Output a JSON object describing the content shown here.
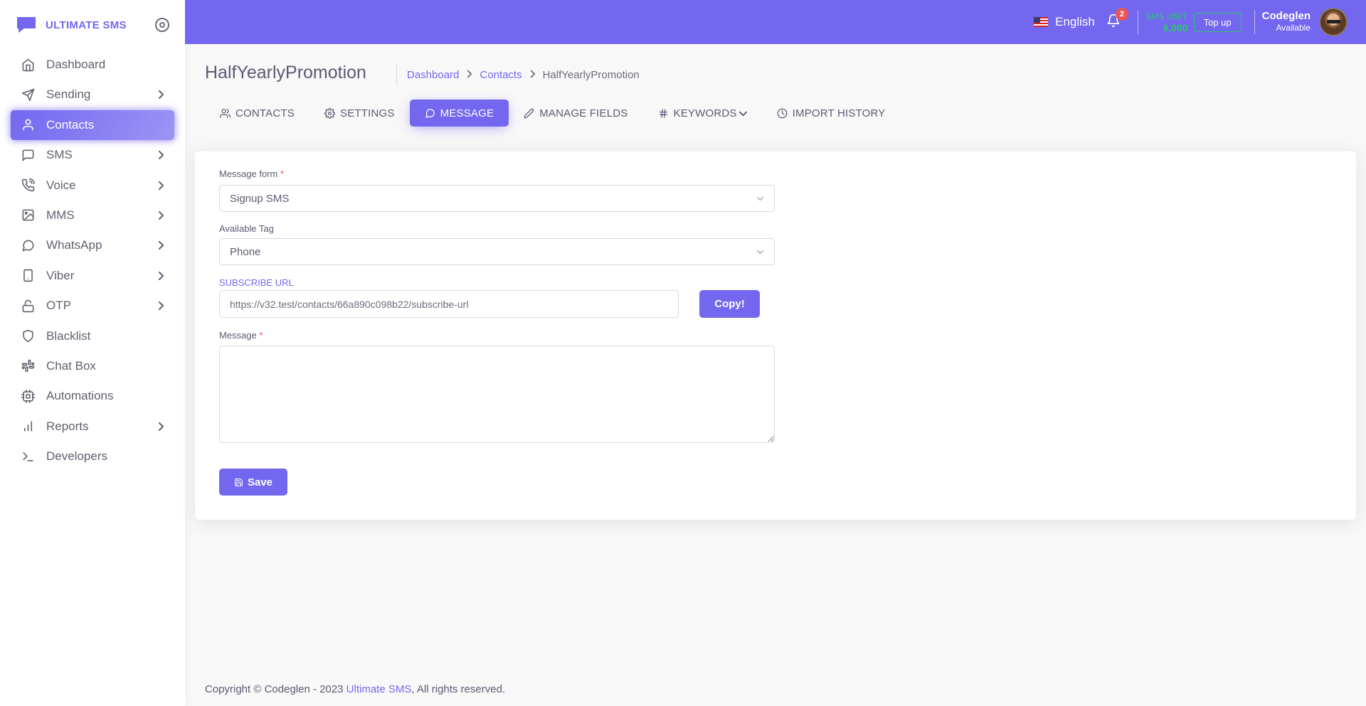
{
  "brand": {
    "name": "ULTIMATE SMS"
  },
  "sidebar": {
    "items": [
      {
        "label": "Dashboard",
        "icon": "home-icon",
        "has_children": false,
        "active": false
      },
      {
        "label": "Sending",
        "icon": "send-icon",
        "has_children": true,
        "active": false
      },
      {
        "label": "Contacts",
        "icon": "user-icon",
        "has_children": false,
        "active": true
      },
      {
        "label": "SMS",
        "icon": "message-square-icon",
        "has_children": true,
        "active": false
      },
      {
        "label": "Voice",
        "icon": "phone-call-icon",
        "has_children": true,
        "active": false
      },
      {
        "label": "MMS",
        "icon": "image-icon",
        "has_children": true,
        "active": false
      },
      {
        "label": "WhatsApp",
        "icon": "message-circle-icon",
        "has_children": true,
        "active": false
      },
      {
        "label": "Viber",
        "icon": "tablet-icon",
        "has_children": true,
        "active": false
      },
      {
        "label": "OTP",
        "icon": "unlock-icon",
        "has_children": true,
        "active": false
      },
      {
        "label": "Blacklist",
        "icon": "shield-icon",
        "has_children": false,
        "active": false
      },
      {
        "label": "Chat Box",
        "icon": "slack-icon",
        "has_children": false,
        "active": false
      },
      {
        "label": "Automations",
        "icon": "cpu-icon",
        "has_children": false,
        "active": false
      },
      {
        "label": "Reports",
        "icon": "bar-chart-icon",
        "has_children": true,
        "active": false
      },
      {
        "label": "Developers",
        "icon": "terminal-icon",
        "has_children": false,
        "active": false
      }
    ]
  },
  "navbar": {
    "language": "English",
    "notification_count": "2",
    "sms_unit_label": "SMS UNIT",
    "sms_unit_value": "6,000",
    "topup_label": "Top up",
    "user_name": "Codeglen",
    "user_status": "Available"
  },
  "header": {
    "title": "HalfYearlyPromotion",
    "breadcrumb": [
      "Dashboard",
      "Contacts",
      "HalfYearlyPromotion"
    ]
  },
  "tabs": [
    {
      "label": "CONTACTS",
      "icon": "users-icon",
      "active": false
    },
    {
      "label": "SETTINGS",
      "icon": "settings-icon",
      "active": false
    },
    {
      "label": "MESSAGE",
      "icon": "message-circle-icon",
      "active": true
    },
    {
      "label": "MANAGE FIELDS",
      "icon": "edit-icon",
      "active": false
    },
    {
      "label": "KEYWORDS",
      "icon": "hash-icon",
      "active": false
    },
    {
      "label": "IMPORT HISTORY",
      "icon": "clock-icon",
      "active": false
    }
  ],
  "form": {
    "message_form_label": "Message form",
    "message_form_value": "Signup SMS",
    "available_tag_label": "Available Tag",
    "available_tag_value": "Phone",
    "subscribe_url_label": "SUBSCRIBE URL",
    "subscribe_url_value": "https://v32.test/contacts/66a890c098b22/subscribe-url",
    "copy_label": "Copy!",
    "message_label": "Message",
    "message_value": "",
    "required_mark": "*",
    "save_label": "Save"
  },
  "footer": {
    "prefix": "Copyright © Codeglen - 2023 ",
    "link": "Ultimate SMS",
    "suffix": ", All rights reserved."
  },
  "colors": {
    "primary": "#7367f0",
    "success": "#28c76f",
    "danger": "#ea5455"
  }
}
